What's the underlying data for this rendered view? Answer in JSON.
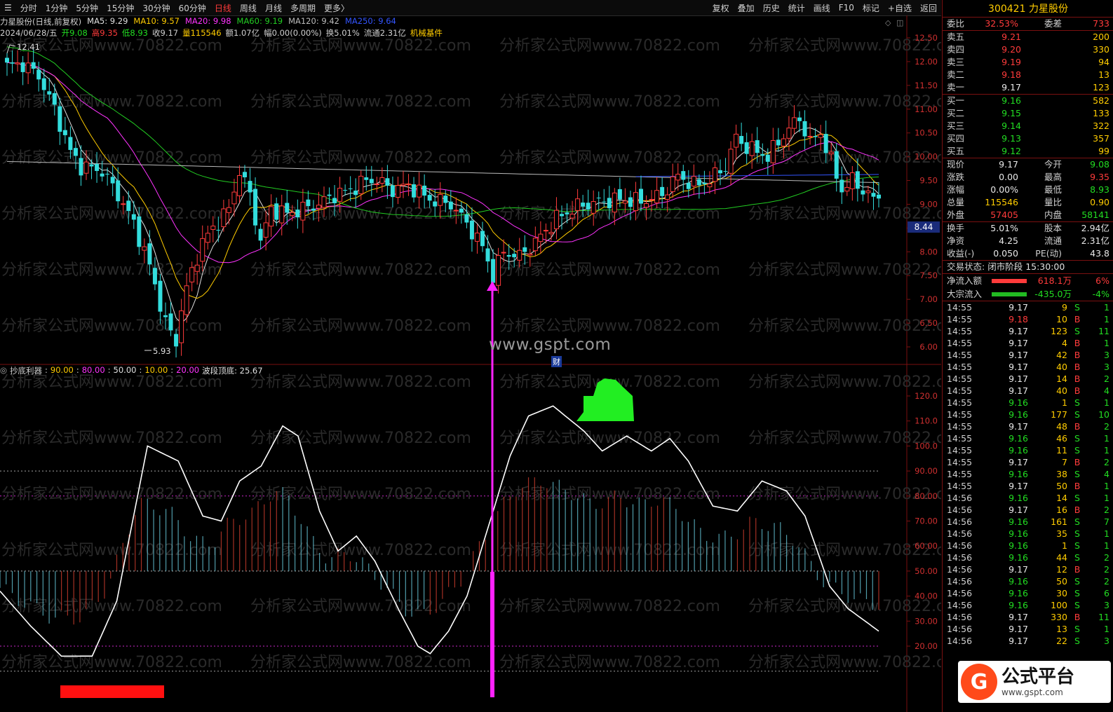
{
  "toolbar": {
    "periods": [
      "分时",
      "1分钟",
      "5分钟",
      "15分钟",
      "30分钟",
      "60分钟",
      "日线",
      "周线",
      "月线",
      "多周期",
      "更多〉"
    ],
    "active_period": "日线",
    "actions": [
      "复权",
      "叠加",
      "历史",
      "统计",
      "画线",
      "F10",
      "标记",
      "+自选",
      "返回"
    ]
  },
  "main_info": {
    "stock": "力星股份(日线,前复权)",
    "ma5": "MA5: 9.29",
    "ma10": "MA10: 9.57",
    "ma20": "MA20: 9.98",
    "ma60": "MA60: 9.19",
    "ma120": "MA120: 9.42",
    "ma250": "MA250: 9.64",
    "date": "2024/06/28/五",
    "open": "开9.08",
    "high": "高9.35",
    "low": "低8.93",
    "close": "收9.17",
    "volume": "量115546",
    "amount": "额1.07亿",
    "change": "幅0.00(0.00%)",
    "turnover": "换5.01%",
    "float": "流通2.31亿",
    "concept": "机械基件"
  },
  "price_axis": [
    "12.50",
    "12.00",
    "11.50",
    "11.00",
    "10.50",
    "10.00",
    "9.50",
    "9.00",
    "8.50",
    "8.00",
    "7.50",
    "7.00",
    "6.50",
    "6.00"
  ],
  "current_price_tag": "8.44",
  "high_marker": "12.41",
  "low_marker": "5.93",
  "indicator_info": {
    "name": "抄底利器",
    "v1": "90.00",
    "v2": "80.00",
    "v3": "50.00",
    "v4": "10.00",
    "v5": "20.00",
    "wave_label": "波段顶底: 25.67"
  },
  "indicator_axis": [
    "120.0",
    "110.0",
    "100.0",
    "90.00",
    "80.00",
    "70.00",
    "60.00",
    "50.00",
    "40.00",
    "30.00",
    "20.00"
  ],
  "watermark_text": "分析家公式网www.70822.com",
  "center_url": "www.gspt.com",
  "cai_label": "财",
  "panel": {
    "title": "300421 力星股份",
    "weibi_label": "委比",
    "weibi": "32.53%",
    "weicha_label": "委差",
    "weicha": "733",
    "asks": [
      {
        "label": "卖五",
        "price": "9.21",
        "vol": "200"
      },
      {
        "label": "卖四",
        "price": "9.20",
        "vol": "330"
      },
      {
        "label": "卖三",
        "price": "9.19",
        "vol": "94"
      },
      {
        "label": "卖二",
        "price": "9.18",
        "vol": "13"
      },
      {
        "label": "卖一",
        "price": "9.17",
        "vol": "123"
      }
    ],
    "bids": [
      {
        "label": "买一",
        "price": "9.16",
        "vol": "582"
      },
      {
        "label": "买二",
        "price": "9.15",
        "vol": "133"
      },
      {
        "label": "买三",
        "price": "9.14",
        "vol": "322"
      },
      {
        "label": "买四",
        "price": "9.13",
        "vol": "357"
      },
      {
        "label": "买五",
        "price": "9.12",
        "vol": "99"
      }
    ],
    "quote": [
      {
        "k1": "现价",
        "v1": "9.17",
        "c1": "white",
        "k2": "今开",
        "v2": "9.08",
        "c2": "green"
      },
      {
        "k1": "涨跌",
        "v1": "0.00",
        "c1": "white",
        "k2": "最高",
        "v2": "9.35",
        "c2": "red"
      },
      {
        "k1": "涨幅",
        "v1": "0.00%",
        "c1": "white",
        "k2": "最低",
        "v2": "8.93",
        "c2": "green"
      },
      {
        "k1": "总量",
        "v1": "115546",
        "c1": "yellow",
        "k2": "量比",
        "v2": "0.90",
        "c2": "yellow"
      },
      {
        "k1": "外盘",
        "v1": "57405",
        "c1": "red",
        "k2": "内盘",
        "v2": "58141",
        "c2": "green"
      }
    ],
    "quote2": [
      {
        "k1": "换手",
        "v1": "5.01%",
        "c1": "white",
        "k2": "股本",
        "v2": "2.94亿",
        "c2": "white"
      },
      {
        "k1": "净资",
        "v1": "4.25",
        "c1": "white",
        "k2": "流通",
        "v2": "2.31亿",
        "c2": "white"
      },
      {
        "k1": "收益(-)",
        "v1": "0.050",
        "c1": "white",
        "k2": "PE(动)",
        "v2": "43.8",
        "c2": "white"
      }
    ],
    "trade_status_label": "交易状态:",
    "trade_status": "闭市阶段 15:30:00",
    "flows": [
      {
        "label": "净流入额",
        "value": "618.1万",
        "pct": "6%",
        "color": "#ff3b3b",
        "cls": "red"
      },
      {
        "label": "大宗流入",
        "value": "-435.0万",
        "pct": "-4%",
        "color": "#22bb22",
        "cls": "green"
      }
    ],
    "ticks": [
      {
        "t": "14:55",
        "p": "9.17",
        "v": "9",
        "bs": "S",
        "n": "1"
      },
      {
        "t": "14:55",
        "p": "9.18",
        "v": "10",
        "bs": "B",
        "n": "1"
      },
      {
        "t": "14:55",
        "p": "9.17",
        "v": "123",
        "bs": "S",
        "n": "11"
      },
      {
        "t": "14:55",
        "p": "9.17",
        "v": "4",
        "bs": "B",
        "n": "1"
      },
      {
        "t": "14:55",
        "p": "9.17",
        "v": "42",
        "bs": "B",
        "n": "3"
      },
      {
        "t": "14:55",
        "p": "9.17",
        "v": "40",
        "bs": "B",
        "n": "3"
      },
      {
        "t": "14:55",
        "p": "9.17",
        "v": "14",
        "bs": "B",
        "n": "2"
      },
      {
        "t": "14:55",
        "p": "9.17",
        "v": "40",
        "bs": "B",
        "n": "4"
      },
      {
        "t": "14:55",
        "p": "9.16",
        "v": "1",
        "bs": "S",
        "n": "1"
      },
      {
        "t": "14:55",
        "p": "9.16",
        "v": "177",
        "bs": "S",
        "n": "10"
      },
      {
        "t": "14:55",
        "p": "9.17",
        "v": "48",
        "bs": "B",
        "n": "2"
      },
      {
        "t": "14:55",
        "p": "9.16",
        "v": "46",
        "bs": "S",
        "n": "1"
      },
      {
        "t": "14:55",
        "p": "9.16",
        "v": "11",
        "bs": "S",
        "n": "1"
      },
      {
        "t": "14:55",
        "p": "9.17",
        "v": "7",
        "bs": "B",
        "n": "2"
      },
      {
        "t": "14:55",
        "p": "9.16",
        "v": "38",
        "bs": "S",
        "n": "4"
      },
      {
        "t": "14:55",
        "p": "9.17",
        "v": "50",
        "bs": "B",
        "n": "1"
      },
      {
        "t": "14:56",
        "p": "9.16",
        "v": "14",
        "bs": "S",
        "n": "1"
      },
      {
        "t": "14:56",
        "p": "9.17",
        "v": "16",
        "bs": "B",
        "n": "2"
      },
      {
        "t": "14:56",
        "p": "9.16",
        "v": "161",
        "bs": "S",
        "n": "7"
      },
      {
        "t": "14:56",
        "p": "9.16",
        "v": "35",
        "bs": "S",
        "n": "1"
      },
      {
        "t": "14:56",
        "p": "9.16",
        "v": "1",
        "bs": "S",
        "n": "1"
      },
      {
        "t": "14:56",
        "p": "9.16",
        "v": "44",
        "bs": "S",
        "n": "2"
      },
      {
        "t": "14:56",
        "p": "9.17",
        "v": "12",
        "bs": "B",
        "n": "2"
      },
      {
        "t": "14:56",
        "p": "9.16",
        "v": "50",
        "bs": "S",
        "n": "2"
      },
      {
        "t": "14:56",
        "p": "9.16",
        "v": "30",
        "bs": "S",
        "n": "6"
      },
      {
        "t": "14:56",
        "p": "9.16",
        "v": "100",
        "bs": "S",
        "n": "3"
      },
      {
        "t": "14:56",
        "p": "9.17",
        "v": "330",
        "bs": "B",
        "n": "11"
      },
      {
        "t": "14:56",
        "p": "9.17",
        "v": "13",
        "bs": "S",
        "n": "1"
      },
      {
        "t": "14:56",
        "p": "9.17",
        "v": "22",
        "bs": "S",
        "n": "3"
      }
    ]
  },
  "logo": {
    "cn": "公式平台",
    "url": "www.gspt.com",
    "mark": "G"
  },
  "colors": {
    "up": "#ff3b3b",
    "down": "#33dddd",
    "ma5": "#e0e0e0",
    "ma10": "#ffcc00",
    "ma20": "#ff33ff",
    "ma60": "#22cc22",
    "ma120": "#bbbbbb",
    "ma250": "#3355ff",
    "signal": "#ff22ff"
  }
}
